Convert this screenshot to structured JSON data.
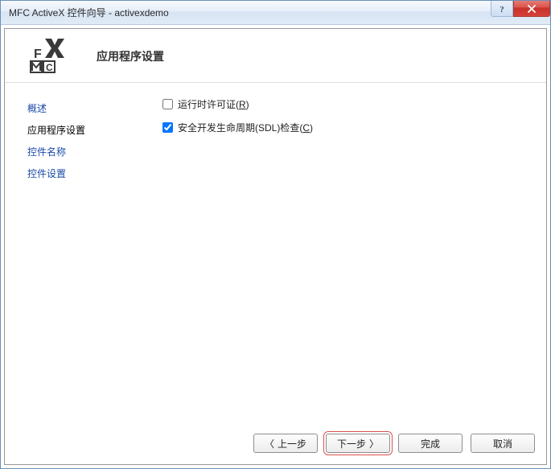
{
  "window": {
    "title": "MFC ActiveX 控件向导 - activexdemo"
  },
  "header": {
    "heading": "应用程序设置"
  },
  "sidebar": {
    "items": [
      {
        "label": "概述",
        "type": "link"
      },
      {
        "label": "应用程序设置",
        "type": "active"
      },
      {
        "label": "控件名称",
        "type": "link"
      },
      {
        "label": "控件设置",
        "type": "link"
      }
    ]
  },
  "main": {
    "checkbox1": {
      "label_pre": "运行时许可证(",
      "key": "R",
      "label_post": ")",
      "checked": false
    },
    "checkbox2": {
      "label_pre": "安全开发生命周期(SDL)检查(",
      "key": "C",
      "label_post": ")",
      "checked": true
    }
  },
  "footer": {
    "prev": "上一步",
    "next": "下一步",
    "finish": "完成",
    "cancel": "取消"
  }
}
